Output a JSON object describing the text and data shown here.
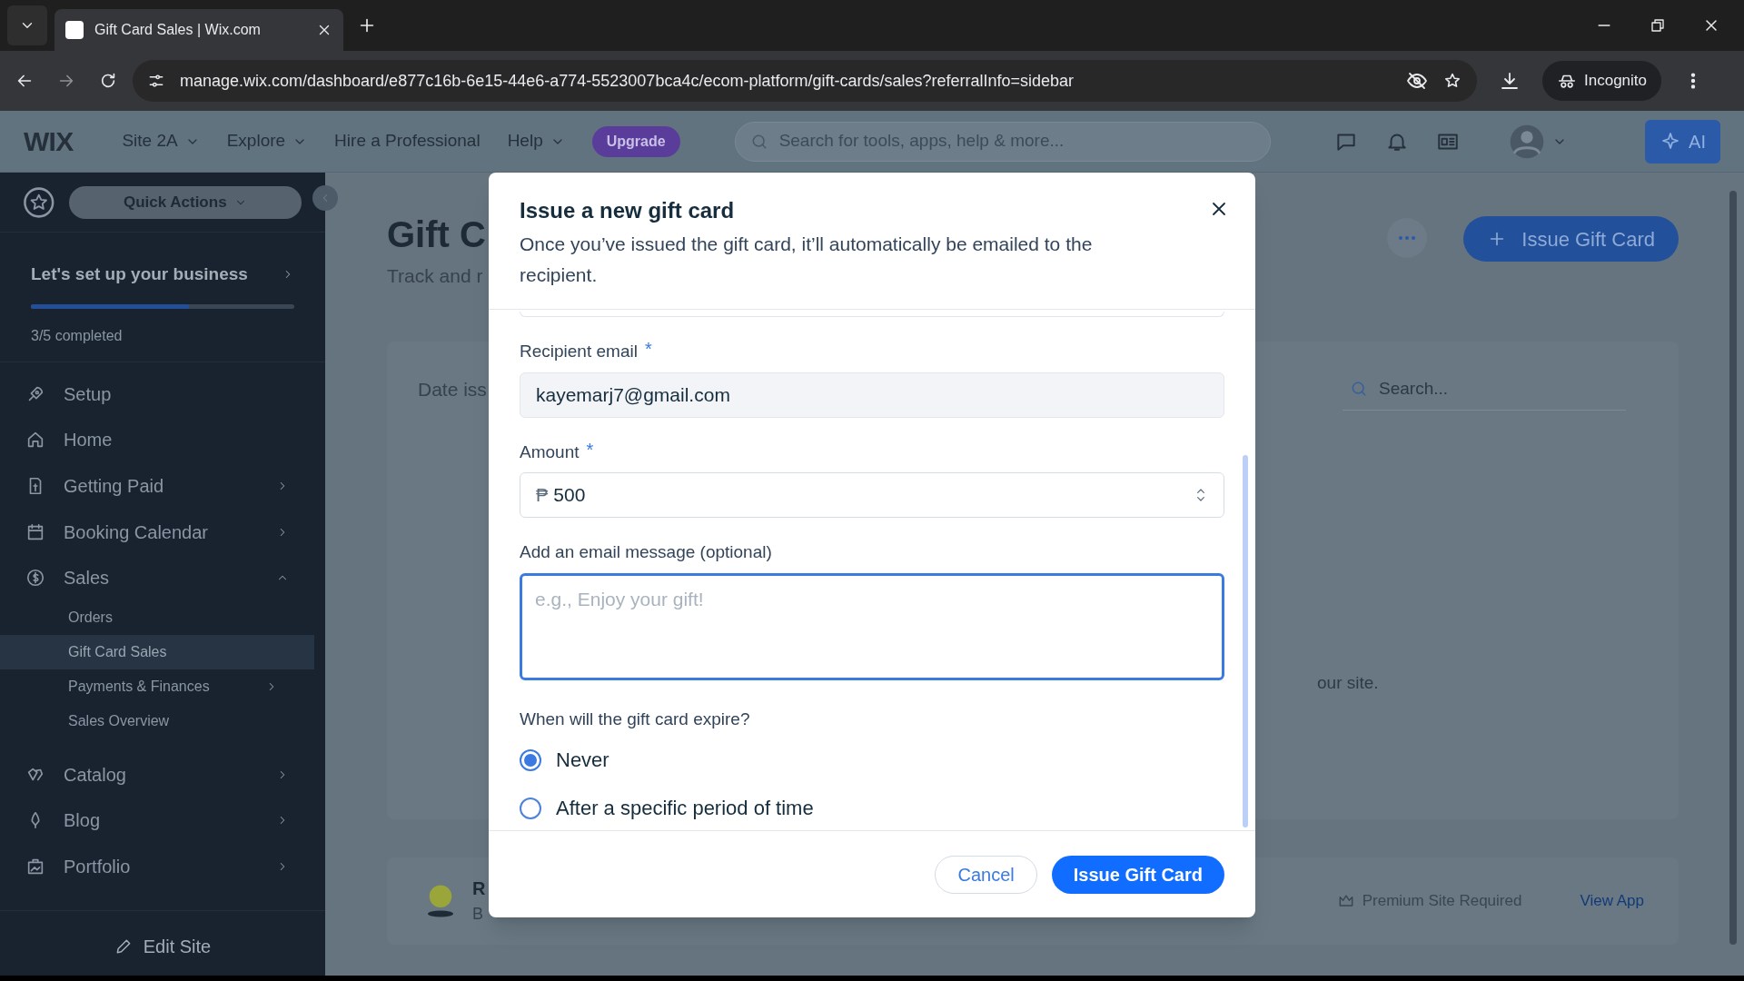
{
  "browser": {
    "tab_title": "Gift Card Sales | Wix.com",
    "url": "manage.wix.com/dashboard/e877c16b-6e15-44e6-a774-5523007bca4c/ecom-platform/gift-cards/sales?referralInfo=sidebar",
    "incognito": "Incognito"
  },
  "topbar": {
    "logo": "WIX",
    "site": "Site 2A",
    "nav": [
      "Explore",
      "Hire a Professional",
      "Help"
    ],
    "upgrade": "Upgrade",
    "search_placeholder": "Search for tools, apps, help & more...",
    "ai": "AI"
  },
  "sidebar": {
    "quick_actions": "Quick Actions",
    "setup": {
      "title": "Let's set up your business",
      "level": 0.6,
      "progress": "3/5 completed"
    },
    "items": [
      {
        "label": "Setup",
        "selected": false
      },
      {
        "label": "Home",
        "selected": false
      },
      {
        "label": "Getting Paid",
        "selected": false,
        "expanded": false
      },
      {
        "label": "Booking Calendar",
        "selected": false,
        "expanded": false
      },
      {
        "label": "Sales",
        "selected": false,
        "expanded": true,
        "children": [
          {
            "label": "Orders",
            "selected": false
          },
          {
            "label": "Gift Card Sales",
            "selected": true
          },
          {
            "label": "Payments & Finances",
            "selected": false,
            "expanded": false
          },
          {
            "label": "Sales Overview",
            "selected": false
          }
        ]
      },
      {
        "label": "Catalog",
        "selected": false,
        "expanded": false
      },
      {
        "label": "Blog",
        "selected": false,
        "expanded": false
      },
      {
        "label": "Portfolio",
        "selected": false,
        "expanded": false
      }
    ],
    "edit_site": "Edit Site"
  },
  "page": {
    "title": "Gift C",
    "subtitle": "Track and r",
    "issue_button": "Issue Gift Card",
    "filter": "Date iss",
    "search_placeholder": "Search...",
    "empty_text": "our site.",
    "app": {
      "name": "R",
      "description": "B",
      "premium": "Premium Site Required",
      "link": "View App"
    }
  },
  "dialog": {
    "title": "Issue a new gift card",
    "description": "Once you’ve issued the gift card, it’ll automatically be emailed to the recipient.",
    "recipient": {
      "label": "Recipient email",
      "required": "*",
      "value": "kayemarj7@gmail.com"
    },
    "amount": {
      "label": "Amount",
      "required": "*",
      "currency": "₱",
      "value": "500"
    },
    "message": {
      "label": "Add an email message (optional)",
      "placeholder": "e.g., Enjoy your gift!"
    },
    "expiry": {
      "question": "When will the gift card expire?",
      "options": [
        {
          "label": "Never",
          "selected": true
        },
        {
          "label": "After a specific period of time",
          "selected": false
        }
      ]
    },
    "buttons": {
      "cancel": "Cancel",
      "issue": "Issue Gift Card"
    }
  }
}
